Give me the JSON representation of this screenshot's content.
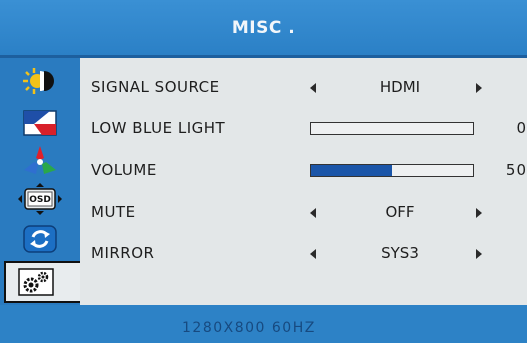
{
  "title": "MISC .",
  "sidebar": {
    "items": [
      {
        "icon": "brightness-icon"
      },
      {
        "icon": "picture-icon"
      },
      {
        "icon": "color-icon"
      },
      {
        "icon": "osd-icon",
        "label": "OSD"
      },
      {
        "icon": "reset-icon"
      },
      {
        "icon": "misc-settings-icon",
        "active": true
      }
    ]
  },
  "menu": {
    "signal_source": {
      "label": "SIGNAL SOURCE",
      "value": "HDMI"
    },
    "low_blue_light": {
      "label": "LOW BLUE LIGHT",
      "value": "0",
      "level": 0
    },
    "volume": {
      "label": "VOLUME",
      "value": "50",
      "level": 0.5
    },
    "mute": {
      "label": "MUTE",
      "value": "OFF"
    },
    "mirror": {
      "label": "MIRROR",
      "value": "SYS3"
    }
  },
  "status": "1280X800  60HZ",
  "colors": {
    "accent": "#2f84c8",
    "panel": "#e3e7e8",
    "bar_fill": "#1a55a8"
  }
}
